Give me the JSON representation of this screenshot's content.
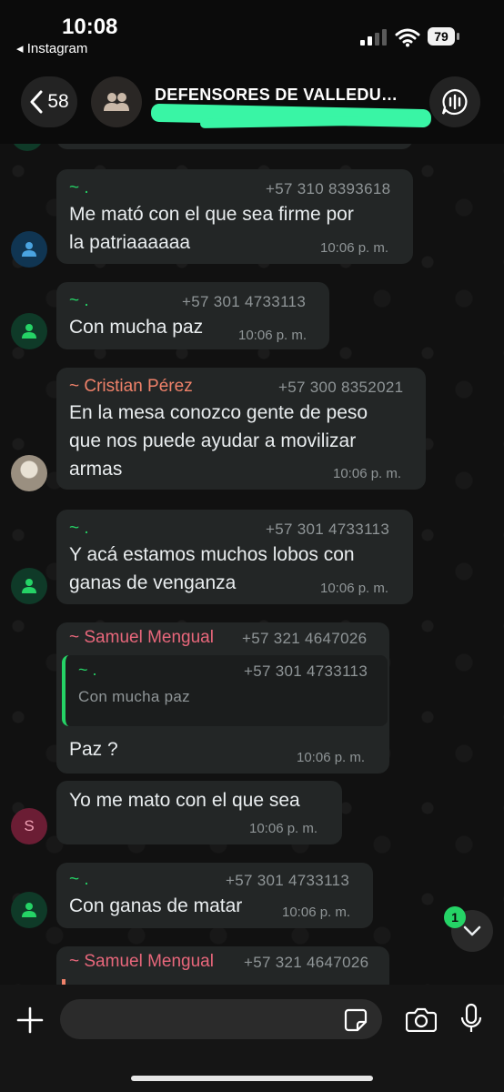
{
  "status_bar": {
    "time": "10:08",
    "back_app": "◂ Instagram",
    "battery": "79"
  },
  "header": {
    "back_count": "58",
    "group_name": "DEFENSORES DE VALLEDU…"
  },
  "messages": [
    {
      "sender": "~ .",
      "phone": "+57 310 8393618",
      "text_lines": [
        "Me mató con el que sea firme por",
        "la patriaaaaaa"
      ],
      "time": "10:06 p. m."
    },
    {
      "sender": "~ .",
      "phone": "+57 301 4733113",
      "text_lines": [
        "Con mucha paz"
      ],
      "time": "10:06 p. m."
    },
    {
      "sender": "~ Cristian Pérez",
      "phone": "+57 300 8352021",
      "text_lines": [
        "En la mesa conozco gente de peso",
        "que nos puede  ayudar a movilizar",
        "armas"
      ],
      "time": "10:06 p. m."
    },
    {
      "sender": "~ .",
      "phone": "+57 301 4733113",
      "text_lines": [
        "Y acá estamos muchos lobos con",
        "ganas de venganza"
      ],
      "time": "10:06 p. m."
    },
    {
      "sender": "~ Samuel Mengual",
      "phone": "+57 321 4647026",
      "quote": {
        "sender": "~ .",
        "phone": "+57 301 4733113",
        "text": "Con mucha paz"
      },
      "text_lines": [
        "Paz ?"
      ],
      "time": "10:06 p. m."
    },
    {
      "avatar_letter": "S",
      "text_lines": [
        "Yo me mato con el que sea"
      ],
      "time": "10:06 p. m."
    },
    {
      "sender": "~ .",
      "phone": "+57 301 4733113",
      "text_lines": [
        "Con ganas de matar"
      ],
      "time": "10:06 p. m."
    },
    {
      "sender": "~ Samuel Mengual",
      "phone": "+57 321 4647026"
    }
  ],
  "scroll_badge": "1",
  "colors": {
    "green_sender": "#25d366",
    "orange_sender": "#f0826a",
    "pink_sender": "#e8677b",
    "bubble": "#232626",
    "background": "#111111"
  },
  "icons": [
    "back-icon",
    "group-icon",
    "voice-chat-icon",
    "person-icon",
    "plus-icon",
    "sticker-icon",
    "camera-icon",
    "mic-icon",
    "chevron-down-icon"
  ]
}
